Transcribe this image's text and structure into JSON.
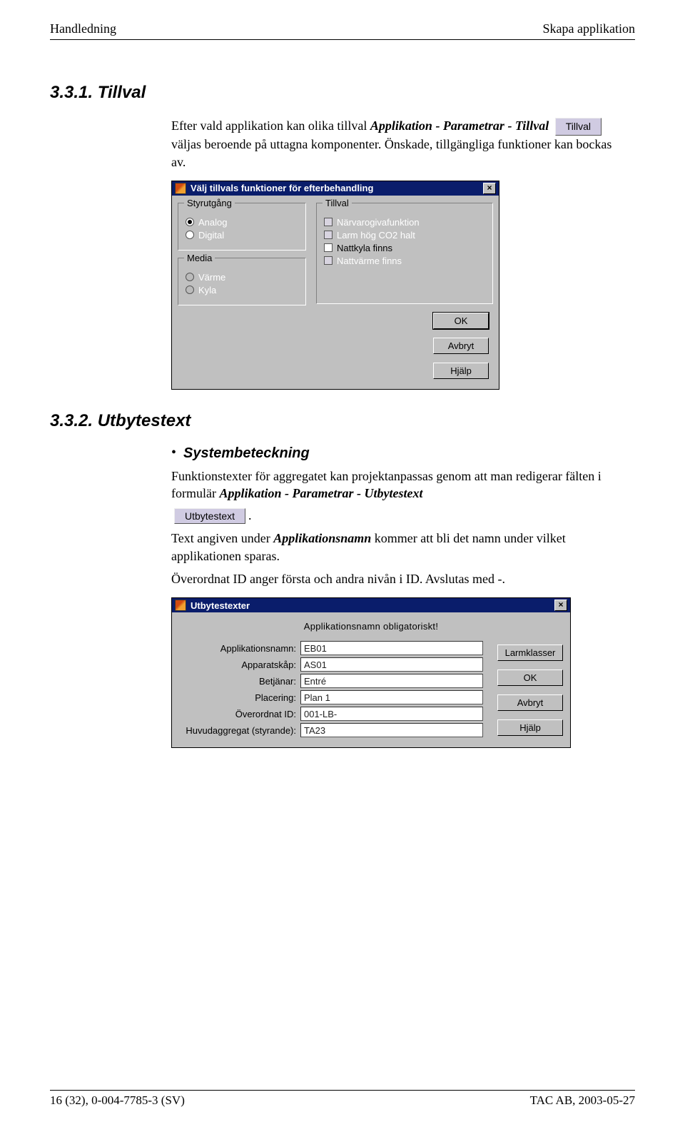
{
  "header": {
    "left": "Handledning",
    "right": "Skapa applikation"
  },
  "sec1": {
    "heading": "3.3.1. Tillval",
    "p1a": "Efter vald applikation kan olika tillval ",
    "p1b": "Applikation - Parametrar - Tillval",
    "btn": "Tillval",
    "p1c": " väljas beroende på uttagna komponenter. Önskade, tillgängliga funktioner kan bockas av."
  },
  "dlg1": {
    "title": "Välj tillvals funktioner för efterbehandling",
    "grp_styr": "Styrutgång",
    "styr_opts": [
      "Analog",
      "Digital"
    ],
    "grp_media": "Media",
    "media_opts": [
      "Värme",
      "Kyla"
    ],
    "grp_tillval": "Tillval",
    "tillval_opts": [
      {
        "label": "Närvarogivafunktion",
        "dark": false
      },
      {
        "label": "Larm hög CO2 halt",
        "dark": false
      },
      {
        "label": "Nattkyla finns",
        "dark": true
      },
      {
        "label": "Nattvärme finns",
        "dark": false
      }
    ],
    "btns": {
      "ok": "OK",
      "cancel": "Avbryt",
      "help": "Hjälp"
    }
  },
  "sec2": {
    "heading": "3.3.2. Utbytestext",
    "bullet": "Systembeteckning",
    "p2a": "Funktionstexter för aggregatet kan projektanpassas genom att man redigerar fälten i formulär ",
    "p2b": "Applikation - Parametrar - Utbytestext",
    "btn": "Utbytestext",
    "p3a": "Text angiven under ",
    "p3b": "Applikationsnamn",
    "p3c": " kommer att bli det namn under vilket applikationen sparas.",
    "p4": "Överordnat ID anger första och andra nivån i ID. Avslutas med -."
  },
  "dlg2": {
    "title": "Utbytestexter",
    "note": "Applikationsnamn obligatoriskt!",
    "fields": [
      {
        "label": "Applikationsnamn:",
        "value": "EB01"
      },
      {
        "label": "Apparatskåp:",
        "value": "AS01"
      },
      {
        "label": "Betjänar:",
        "value": "Entré"
      },
      {
        "label": "Placering:",
        "value": "Plan 1"
      },
      {
        "label": "Överordnat ID:",
        "value": "001-LB-"
      },
      {
        "label": "Huvudaggregat (styrande):",
        "value": "TA23"
      }
    ],
    "btns": {
      "classes": "Larmklasser",
      "ok": "OK",
      "cancel": "Avbryt",
      "help": "Hjälp"
    }
  },
  "footer": {
    "left": "16 (32), 0-004-7785-3 (SV)",
    "right": "TAC AB, 2003-05-27"
  }
}
